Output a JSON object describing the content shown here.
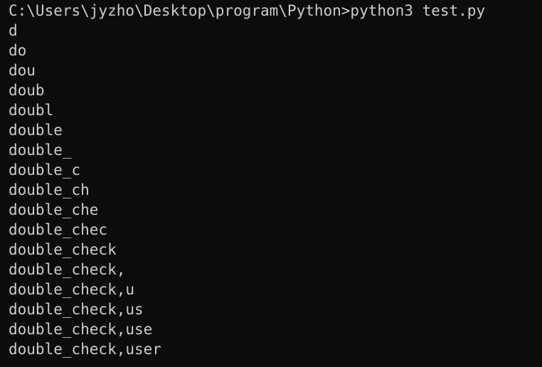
{
  "terminal": {
    "colors": {
      "background": "#0c0c0c",
      "foreground": "#cccccc"
    },
    "lines": [
      "C:\\Users\\jyzho\\Desktop\\program\\Python>python3 test.py",
      "d",
      "do",
      "dou",
      "doub",
      "doubl",
      "double",
      "double_",
      "double_c",
      "double_ch",
      "double_che",
      "double_chec",
      "double_check",
      "double_check,",
      "double_check,u",
      "double_check,us",
      "double_check,use",
      "double_check,user"
    ]
  }
}
